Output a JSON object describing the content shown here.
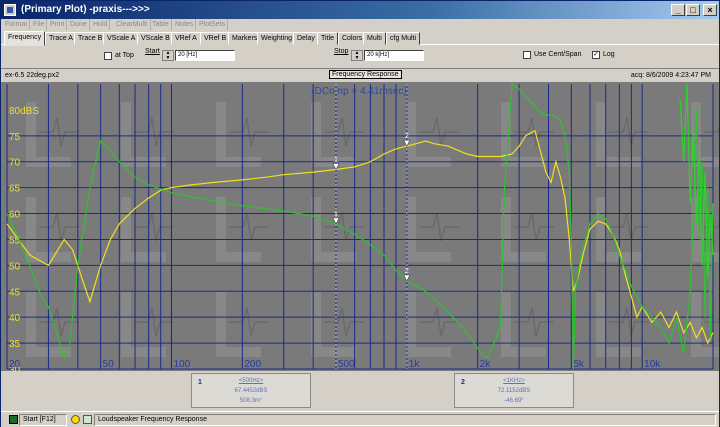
{
  "window": {
    "title": "(Primary Plot) -praxis--->>>",
    "min_label": "_",
    "max_label": "□",
    "close_label": "×"
  },
  "menu": [
    "Format",
    "File",
    "Print",
    "Done",
    "Hold",
    "ClearMulti",
    "Table",
    "Notes",
    "PlotSets"
  ],
  "tabs": [
    "Frequency",
    "Trace A",
    "Trace B",
    "VScale A",
    "VScale B",
    "VRef A",
    "VRef B",
    "Markers",
    "Weighting",
    "Delay",
    "Title",
    "Colors",
    "Multi",
    "cfg Multi"
  ],
  "active_tab": "Frequency",
  "controls": {
    "at_top_label": "at Top",
    "at_top_checked": false,
    "start_label": "Start",
    "start_value": "20 [Hz]",
    "stop_label": "Stop",
    "stop_value": "20 k[Hz]",
    "use_cent_span_label": "Use Cent/Span",
    "use_cent_span_checked": false,
    "log_label": "Log",
    "log_checked": true,
    "check_mark": "✓"
  },
  "plot_header": {
    "file_name": "ex-6.5 22deg.px2",
    "title": "Frequency Response",
    "acq": "acq: 8/6/2009 4:23:47 PM"
  },
  "chart_data": {
    "type": "line",
    "title": "Frequency Response",
    "annotation": "(DComp = 4.41msec)",
    "x_scale": "log",
    "xlim": [
      20,
      20000
    ],
    "ylim": [
      30,
      85
    ],
    "y_unit_label": "80dBS",
    "y_ticks": [
      30,
      35,
      40,
      45,
      50,
      55,
      60,
      65,
      70,
      75
    ],
    "x_tick_labels": [
      {
        "value": 20,
        "label": "20"
      },
      {
        "value": 50,
        "label": "50"
      },
      {
        "value": 100,
        "label": "100"
      },
      {
        "value": 200,
        "label": "200"
      },
      {
        "value": 500,
        "label": "500"
      },
      {
        "value": 1000,
        "label": "1k"
      },
      {
        "value": 2000,
        "label": "2k"
      },
      {
        "value": 5000,
        "label": "5k"
      },
      {
        "value": 10000,
        "label": "10k"
      }
    ],
    "grid": true,
    "series": [
      {
        "color": "#f0e020",
        "points": [
          [
            20,
            58
          ],
          [
            25,
            52
          ],
          [
            30,
            50
          ],
          [
            35,
            55
          ],
          [
            38,
            53
          ],
          [
            42,
            47
          ],
          [
            45,
            43
          ],
          [
            50,
            50
          ],
          [
            55,
            55
          ],
          [
            60,
            58
          ],
          [
            70,
            61
          ],
          [
            80,
            63
          ],
          [
            90,
            64.5
          ],
          [
            100,
            65
          ],
          [
            120,
            65.5
          ],
          [
            150,
            66
          ],
          [
            200,
            66.5
          ],
          [
            250,
            67
          ],
          [
            300,
            67.5
          ],
          [
            400,
            68
          ],
          [
            500,
            68.5
          ],
          [
            600,
            69
          ],
          [
            700,
            70
          ],
          [
            800,
            71.5
          ],
          [
            900,
            72.5
          ],
          [
            1000,
            73
          ],
          [
            1100,
            73.5
          ],
          [
            1200,
            74
          ],
          [
            1300,
            73.5
          ],
          [
            1500,
            73
          ],
          [
            1800,
            71.5
          ],
          [
            2000,
            71
          ],
          [
            2200,
            71
          ],
          [
            2500,
            71
          ],
          [
            2800,
            71.5
          ],
          [
            3000,
            73
          ],
          [
            3200,
            75
          ],
          [
            3500,
            76
          ],
          [
            3700,
            72
          ],
          [
            3900,
            68
          ],
          [
            4100,
            66
          ],
          [
            4300,
            70
          ],
          [
            4500,
            67
          ],
          [
            4700,
            63
          ],
          [
            4900,
            55
          ],
          [
            5100,
            45
          ],
          [
            5300,
            47
          ],
          [
            5600,
            52
          ],
          [
            6000,
            57
          ],
          [
            6500,
            58.5
          ],
          [
            7000,
            58
          ],
          [
            7500,
            56
          ],
          [
            8000,
            53
          ],
          [
            8500,
            48
          ],
          [
            9000,
            44
          ],
          [
            9500,
            40
          ],
          [
            10000,
            42
          ],
          [
            11000,
            39
          ],
          [
            12000,
            41
          ],
          [
            13000,
            38
          ],
          [
            14000,
            41
          ],
          [
            15000,
            37
          ],
          [
            16000,
            39
          ],
          [
            17000,
            36
          ],
          [
            18000,
            38
          ],
          [
            19000,
            35
          ],
          [
            20000,
            37
          ]
        ]
      },
      {
        "color": "#2ec22e",
        "points": [
          [
            20,
            60
          ],
          [
            22,
            56
          ],
          [
            25,
            50
          ],
          [
            28,
            44
          ],
          [
            30,
            42
          ],
          [
            33,
            36
          ],
          [
            35,
            32
          ],
          [
            37,
            35
          ],
          [
            40,
            50
          ],
          [
            45,
            65
          ],
          [
            50,
            74
          ],
          [
            55,
            72
          ],
          [
            60,
            70
          ],
          [
            70,
            67
          ],
          [
            80,
            65.5
          ],
          [
            100,
            64
          ],
          [
            130,
            63
          ],
          [
            150,
            62.5
          ],
          [
            200,
            61.5
          ],
          [
            300,
            60.5
          ],
          [
            400,
            59.5
          ],
          [
            500,
            58
          ],
          [
            600,
            56
          ],
          [
            700,
            54
          ],
          [
            800,
            52
          ],
          [
            900,
            49
          ],
          [
            1000,
            47
          ],
          [
            1200,
            45
          ],
          [
            1500,
            41
          ],
          [
            1800,
            37
          ],
          [
            2000,
            34
          ],
          [
            2200,
            32
          ],
          [
            2500,
            38
          ],
          [
            2600,
            65
          ],
          [
            2800,
            85
          ],
          [
            3000,
            84
          ],
          [
            3300,
            82
          ],
          [
            3600,
            80
          ],
          [
            3900,
            79
          ],
          [
            4200,
            79
          ],
          [
            4500,
            78
          ],
          [
            4700,
            75
          ],
          [
            4900,
            68
          ],
          [
            5000,
            55
          ],
          [
            5100,
            30
          ],
          [
            5200,
            45
          ],
          [
            5500,
            52
          ],
          [
            6000,
            58
          ],
          [
            6500,
            60
          ],
          [
            7000,
            59
          ],
          [
            7500,
            56
          ],
          [
            8000,
            52
          ],
          [
            9000,
            46
          ],
          [
            10000,
            42
          ],
          [
            11000,
            40
          ],
          [
            12000,
            38
          ],
          [
            13000,
            35
          ],
          [
            14000,
            40
          ],
          [
            15000,
            33
          ],
          [
            16000,
            45
          ],
          [
            16500,
            60
          ],
          [
            17000,
            80
          ],
          [
            17500,
            55
          ],
          [
            18000,
            70
          ],
          [
            18500,
            40
          ],
          [
            19000,
            65
          ],
          [
            19500,
            36
          ],
          [
            20000,
            62
          ]
        ]
      },
      {
        "color": "#30d030",
        "points": [
          [
            14500,
            82
          ],
          [
            15000,
            70
          ],
          [
            15500,
            85
          ],
          [
            16000,
            62
          ],
          [
            16500,
            76
          ],
          [
            17000,
            58
          ],
          [
            17500,
            72
          ],
          [
            18000,
            50
          ],
          [
            18500,
            68
          ],
          [
            19000,
            48
          ],
          [
            19500,
            60
          ],
          [
            20000,
            52
          ]
        ]
      }
    ],
    "markers": [
      {
        "id": "1",
        "x": 500
      },
      {
        "id": "2",
        "x": 1000
      }
    ]
  },
  "readouts": [
    {
      "num": "1",
      "freq": "<500Hz>",
      "level": "67.4452dBS",
      "extra": "508.3m°"
    },
    {
      "num": "2",
      "freq": "<1KHz>",
      "level": "72.1152dBS",
      "extra": "-46.69°"
    }
  ],
  "status": {
    "start_label": "Start [F12]",
    "description": "Loudspeaker Frequency Response"
  }
}
